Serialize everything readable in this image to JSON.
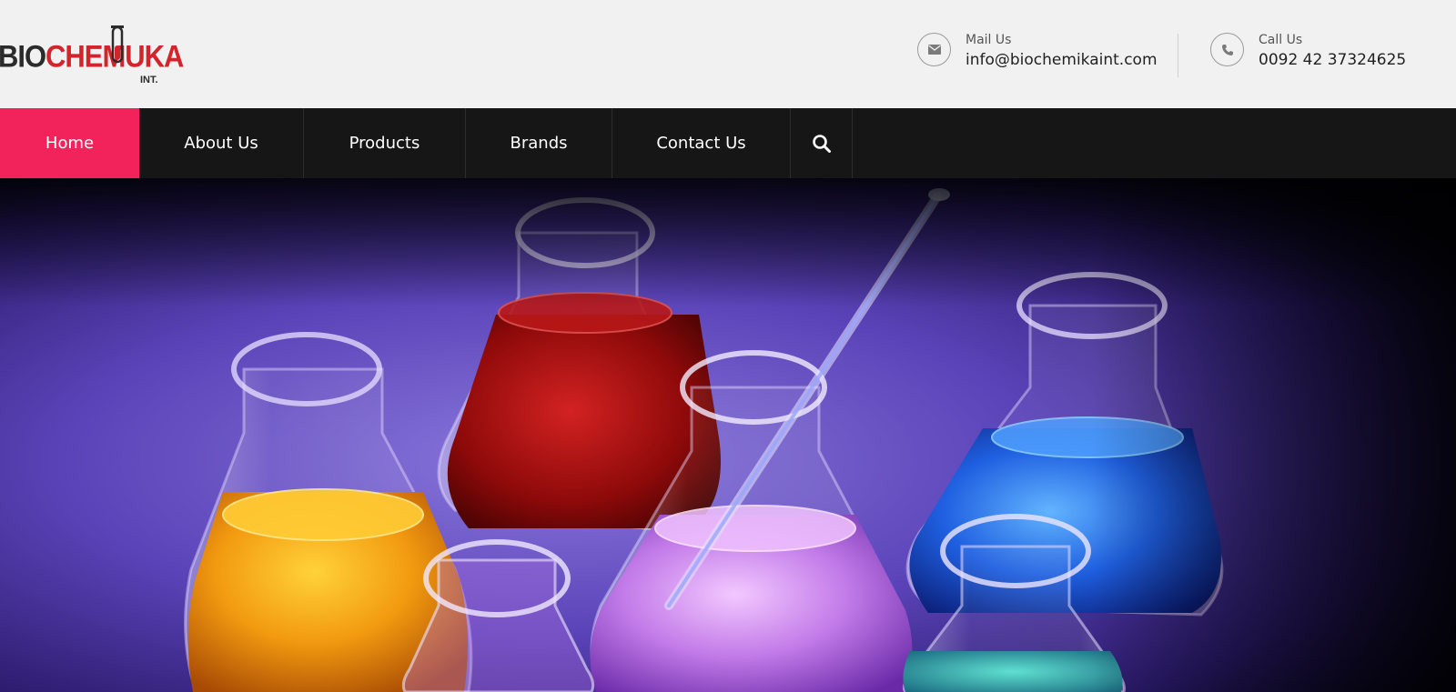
{
  "brand": {
    "part1": "BIO",
    "part2": "CHEMUKA",
    "suffix": "INT.",
    "colors": {
      "dark": "#2b2b2b",
      "red": "#d3232b"
    }
  },
  "contact": {
    "mail": {
      "icon": "envelope-icon",
      "label": "Mail Us",
      "value": "info@biochemikaint.com"
    },
    "call": {
      "icon": "phone-icon",
      "label": "Call Us",
      "value": "0092 42 37324625"
    }
  },
  "nav": {
    "items": [
      {
        "label": "Home",
        "active": true
      },
      {
        "label": "About Us",
        "active": false
      },
      {
        "label": "Products",
        "active": false
      },
      {
        "label": "Brands",
        "active": false
      },
      {
        "label": "Contact Us",
        "active": false
      }
    ],
    "search_icon": "search-icon",
    "colors": {
      "bar": "#161616",
      "active": "#f2225a",
      "text": "#ffffff"
    }
  },
  "hero": {
    "image": "laboratory-flasks-with-colored-liquids",
    "liquids": [
      "orange",
      "red",
      "violet",
      "blue",
      "teal"
    ]
  }
}
